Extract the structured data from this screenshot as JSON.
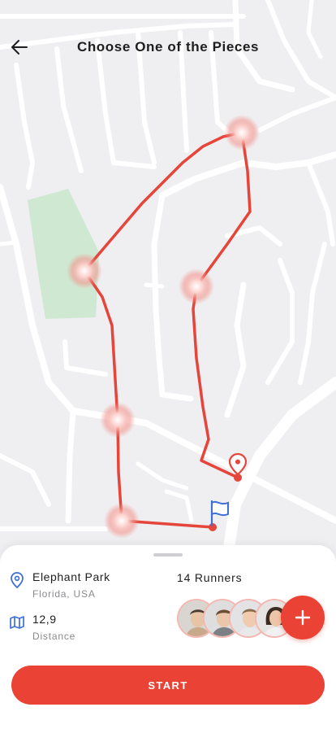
{
  "header": {
    "title": "Choose One of the Pieces"
  },
  "location": {
    "name": "Elephant Park",
    "region": "Florida, USA"
  },
  "distance": {
    "value": "12,9",
    "label": "Distance"
  },
  "runners": {
    "label": "14 Runners",
    "avatar_count": 4
  },
  "start_button": {
    "label": "START"
  },
  "icons": {
    "back": "arrow-left-icon",
    "location": "map-pin-icon",
    "distance": "map-icon",
    "finish": "flag-icon",
    "destination": "location-pin-icon",
    "add": "plus-icon"
  },
  "colors": {
    "accent": "#ea4335",
    "park": "#cfe8d2",
    "map_bg": "#efeff1",
    "road": "#ffffff",
    "flag": "#3d6fd8",
    "icon_blue": "#3d6fd8"
  }
}
